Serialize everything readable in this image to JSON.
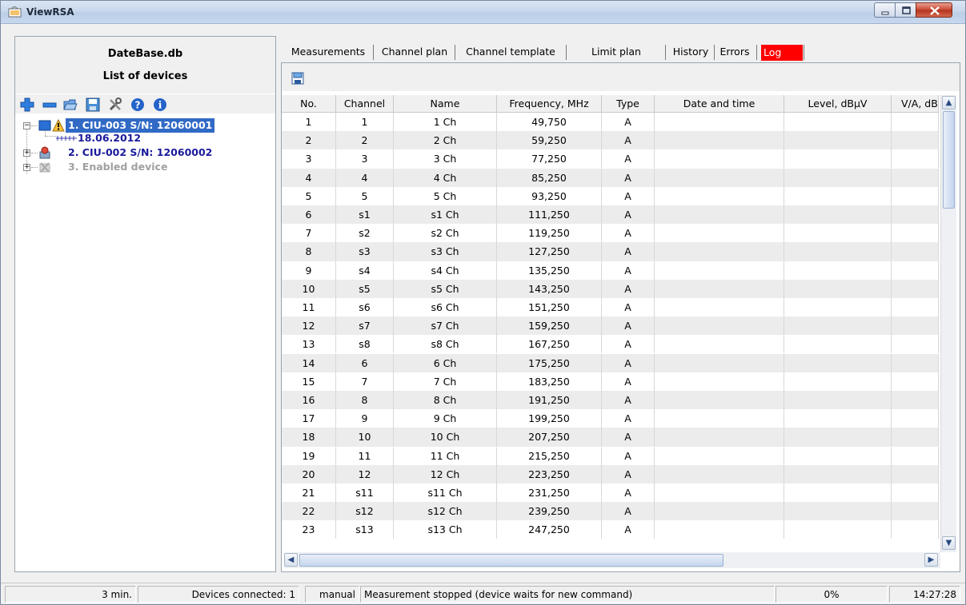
{
  "window": {
    "title": "ViewRSA",
    "controls": {
      "minimize": "minimize-icon",
      "maximize": "maximize-icon",
      "close": "close-icon"
    }
  },
  "left_panel": {
    "db_name": "DateBase.db",
    "list_title": "List of devices",
    "toolbar_icons": [
      "add-icon",
      "remove-icon",
      "open-folder-icon",
      "save-icon",
      "settings-icon",
      "help-icon",
      "info-icon"
    ],
    "tree": [
      {
        "label": "1. CIU-003 S/N: 12060001",
        "selected": true,
        "color": "#1a1a9a",
        "icon": "device-warning-icon"
      },
      {
        "label": "18.06.2012",
        "color": "#1a1a9a",
        "icon": "measurement-icon"
      },
      {
        "label": "2. CIU-002 S/N: 12060002",
        "color": "#1a1a9a",
        "icon": "device-error-icon"
      },
      {
        "label": "3. Enabled device",
        "color": "#a0a0a0",
        "icon": "device-disabled-icon"
      }
    ]
  },
  "tabs": [
    {
      "label": "Measurements",
      "active": true
    },
    {
      "label": "Channel plan"
    },
    {
      "label": "Channel template"
    },
    {
      "label": "Limit plan"
    },
    {
      "label": "History"
    },
    {
      "label": "Errors"
    },
    {
      "label": "Log",
      "highlight": "#ff0000"
    }
  ],
  "table": {
    "save_icon": "save-icon",
    "columns": [
      "No.",
      "Channel",
      "Name",
      "Frequency, MHz",
      "Type",
      "Date and time",
      "Level, dBµV",
      "V/A, dB"
    ],
    "rows": [
      [
        "1",
        "1",
        "1 Ch",
        "49,750",
        "A"
      ],
      [
        "2",
        "2",
        "2 Ch",
        "59,250",
        "A"
      ],
      [
        "3",
        "3",
        "3 Ch",
        "77,250",
        "A"
      ],
      [
        "4",
        "4",
        "4 Ch",
        "85,250",
        "A"
      ],
      [
        "5",
        "5",
        "5 Ch",
        "93,250",
        "A"
      ],
      [
        "6",
        "s1",
        "s1 Ch",
        "111,250",
        "A"
      ],
      [
        "7",
        "s2",
        "s2 Ch",
        "119,250",
        "A"
      ],
      [
        "8",
        "s3",
        "s3 Ch",
        "127,250",
        "A"
      ],
      [
        "9",
        "s4",
        "s4 Ch",
        "135,250",
        "A"
      ],
      [
        "10",
        "s5",
        "s5 Ch",
        "143,250",
        "A"
      ],
      [
        "11",
        "s6",
        "s6 Ch",
        "151,250",
        "A"
      ],
      [
        "12",
        "s7",
        "s7 Ch",
        "159,250",
        "A"
      ],
      [
        "13",
        "s8",
        "s8 Ch",
        "167,250",
        "A"
      ],
      [
        "14",
        "6",
        "6 Ch",
        "175,250",
        "A"
      ],
      [
        "15",
        "7",
        "7 Ch",
        "183,250",
        "A"
      ],
      [
        "16",
        "8",
        "8 Ch",
        "191,250",
        "A"
      ],
      [
        "17",
        "9",
        "9 Ch",
        "199,250",
        "A"
      ],
      [
        "18",
        "10",
        "10 Ch",
        "207,250",
        "A"
      ],
      [
        "19",
        "11",
        "11 Ch",
        "215,250",
        "A"
      ],
      [
        "20",
        "12",
        "12 Ch",
        "223,250",
        "A"
      ],
      [
        "21",
        "s11",
        "s11 Ch",
        "231,250",
        "A"
      ],
      [
        "22",
        "s12",
        "s12 Ch",
        "239,250",
        "A"
      ],
      [
        "23",
        "s13",
        "s13 Ch",
        "247,250",
        "A"
      ]
    ]
  },
  "status_bar": {
    "interval": "3 min.",
    "devices_connected": "Devices connected: 1",
    "mode": "manual",
    "message": "Measurement stopped (device waits for new command)",
    "progress": "0%",
    "time": "14:27:28"
  },
  "colors": {
    "accent": "#2f6fd8",
    "selection": "#316ac5",
    "tree_text": "#1a1a9a",
    "log_tab": "#ff0000"
  }
}
